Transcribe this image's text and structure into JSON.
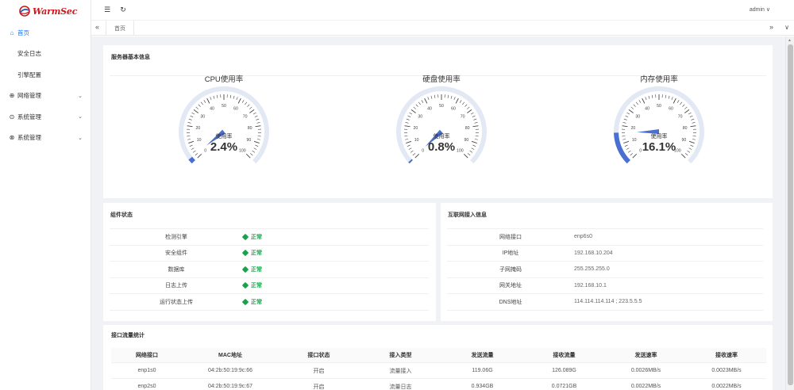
{
  "brand": {
    "name": "WarmSec"
  },
  "header": {
    "user": "admin",
    "user_arrow": "∨",
    "menu_icon": "☰",
    "refresh_icon": "↻"
  },
  "sidebar": {
    "items": [
      {
        "icon": "⌂",
        "icon_name": "home-icon",
        "label": "首页",
        "active": true,
        "arrow": ""
      },
      {
        "icon": "",
        "icon_name": "",
        "label": "安全日志",
        "active": false,
        "arrow": ""
      },
      {
        "icon": "",
        "icon_name": "",
        "label": "引擎配置",
        "active": false,
        "arrow": ""
      },
      {
        "icon": "⊕",
        "icon_name": "network-icon",
        "label": "网络管理",
        "active": false,
        "arrow": "⌄"
      },
      {
        "icon": "⊙",
        "icon_name": "system-icon",
        "label": "系统管理",
        "active": false,
        "arrow": "⌄"
      },
      {
        "icon": "⊗",
        "icon_name": "settings-icon",
        "label": "系统管理",
        "active": false,
        "arrow": "⌄"
      }
    ]
  },
  "tabs": {
    "left": "«",
    "right": "»",
    "down": "∨",
    "items": [
      {
        "label": "首页"
      }
    ]
  },
  "server_info": {
    "title": "服务器基本信息",
    "gauges": [
      {
        "title": "CPU使用率",
        "label": "使用率",
        "value": 2.4,
        "display": "2.4%"
      },
      {
        "title": "硬盘使用率",
        "label": "使用率",
        "value": 0.8,
        "display": "0.8%"
      },
      {
        "title": "内存使用率",
        "label": "使用率",
        "value": 16.1,
        "display": "16.1%"
      }
    ],
    "ticks": [
      "0",
      "10",
      "20",
      "30",
      "40",
      "50",
      "60",
      "70",
      "80",
      "90",
      "100"
    ],
    "accent": "#4a6fd1",
    "track": "#e3e8f5"
  },
  "components": {
    "title": "组件状态",
    "rows": [
      {
        "name": "检测引擎",
        "status": "正常"
      },
      {
        "name": "安全组件",
        "status": "正常"
      },
      {
        "name": "数据库",
        "status": "正常"
      },
      {
        "name": "日志上传",
        "status": "正常"
      },
      {
        "name": "运行状态上传",
        "status": "正常"
      }
    ],
    "status_color": "#16a34a"
  },
  "network": {
    "title": "互联网接入信息",
    "rows": [
      {
        "label": "网络接口",
        "value": "enp6s0"
      },
      {
        "label": "IP地址",
        "value": "192.168.10.204"
      },
      {
        "label": "子网掩码",
        "value": "255.255.255.0"
      },
      {
        "label": "网关地址",
        "value": "192.168.10.1"
      },
      {
        "label": "DNS地址",
        "value": "114.114.114.114 ; 223.5.5.5"
      }
    ]
  },
  "traffic": {
    "title": "接口流量统计",
    "columns": [
      "网络接口",
      "MAC地址",
      "接口状态",
      "接入类型",
      "发送流量",
      "接收流量",
      "发送速率",
      "接收速率"
    ],
    "rows": [
      [
        "enp1s0",
        "04:2b:50:19:9c:66",
        "开启",
        "流量接入",
        "119.06G",
        "126.089G",
        "0.0026MB/s",
        "0.0023MB/s"
      ],
      [
        "enp2s0",
        "04:2b:50:19:9c:67",
        "开启",
        "流量日志",
        "0.934GB",
        "0.0721GB",
        "0.0022MB/s",
        "0.0022MB/s"
      ]
    ]
  }
}
